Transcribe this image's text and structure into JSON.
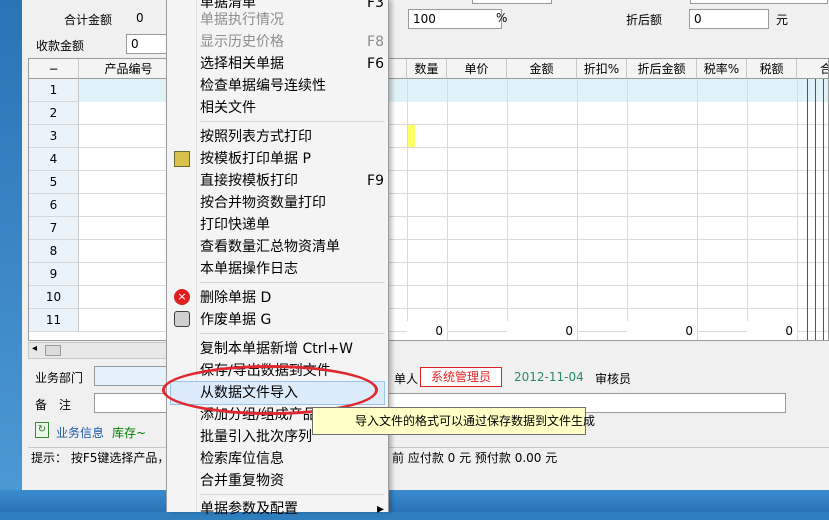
{
  "form": {
    "total_amount_label": "合计金额",
    "total_amount_value": "0",
    "received_amount_label": "收款金额",
    "received_amount_value": "0",
    "rate_value": "100",
    "rate_unit": "%",
    "discount_amount_label": "折后额",
    "discount_amount_value": "0",
    "discount_unit": "元"
  },
  "grid": {
    "headers": [
      "−",
      "产品编号",
      "数量",
      "单价",
      "金额",
      "折扣%",
      "折后金额",
      "税率%",
      "税额",
      "合"
    ],
    "row_numbers": [
      "1",
      "2",
      "3",
      "4",
      "5",
      "6",
      "7",
      "8",
      "9",
      "10",
      "11"
    ],
    "totals": [
      "0",
      "0",
      "0",
      "0"
    ]
  },
  "bottom": {
    "dept_label": "业务部门",
    "remark_label": "备　注",
    "maker_label": "单人",
    "maker_value": "系统管理员",
    "date_value": "2012-11-04",
    "auditor_label": "审核员",
    "biz_info_label": "业务信息",
    "stock_label": "库存~",
    "status_left": "提示： 按F5键选择产品，",
    "status_right": "前 应付款 0 元 预付款 0.00 元"
  },
  "menu": {
    "items": [
      {
        "label": "单据清单",
        "shortcut": "F3",
        "disabled": false
      },
      {
        "label": "单据执行情况",
        "shortcut": "",
        "disabled": true
      },
      {
        "label": "显示历史价格",
        "shortcut": "F8",
        "disabled": true
      },
      {
        "label": "选择相关单据",
        "shortcut": "F6",
        "disabled": false
      },
      {
        "label": "检查单据编号连续性",
        "shortcut": "",
        "disabled": false
      },
      {
        "label": "相关文件",
        "shortcut": "",
        "disabled": false
      },
      {
        "label": "按照列表方式打印",
        "shortcut": "",
        "disabled": false
      },
      {
        "label": "按模板打印单据  P",
        "shortcut": "",
        "disabled": false
      },
      {
        "label": "直接按模板打印",
        "shortcut": "F9",
        "disabled": false
      },
      {
        "label": "按合并物资数量打印",
        "shortcut": "",
        "disabled": false
      },
      {
        "label": "打印快递单",
        "shortcut": "",
        "disabled": false
      },
      {
        "label": "查看数量汇总物资清单",
        "shortcut": "",
        "disabled": false
      },
      {
        "label": "本单据操作日志",
        "shortcut": "",
        "disabled": false
      },
      {
        "label": "删除单据  D",
        "shortcut": "",
        "disabled": false
      },
      {
        "label": "作废单据  G",
        "shortcut": "",
        "disabled": false
      },
      {
        "label": "复制本单据新增  Ctrl+W",
        "shortcut": "",
        "disabled": false
      },
      {
        "label": "保存/导出数据到文件",
        "shortcut": "",
        "disabled": false
      },
      {
        "label": "从数据文件导入",
        "shortcut": "",
        "disabled": false
      },
      {
        "label": "添加分组/组成产品",
        "shortcut": "",
        "disabled": false
      },
      {
        "label": "批量引入批次序列",
        "shortcut": "",
        "disabled": false
      },
      {
        "label": "检索库位信息",
        "shortcut": "",
        "disabled": false
      },
      {
        "label": "合并重复物资",
        "shortcut": "",
        "disabled": false
      },
      {
        "label": "单据参数及配置",
        "shortcut": "▸",
        "disabled": false
      }
    ]
  },
  "tooltip": {
    "text": "导入文件的格式可以通过保存数据到文件生成"
  },
  "colors": {
    "accent_highlight": "#dcebfa",
    "annotation_red": "#e0282e",
    "tooltip_bg": "#ffffc6",
    "green_text": "#008000"
  }
}
